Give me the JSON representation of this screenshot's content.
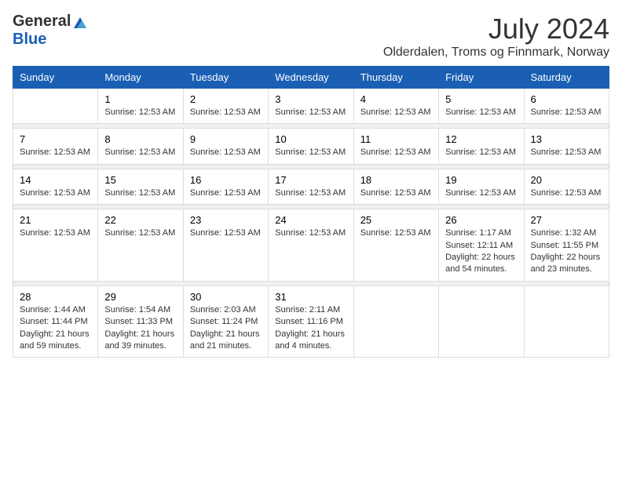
{
  "logo": {
    "general": "General",
    "blue": "Blue"
  },
  "title": "July 2024",
  "location": "Olderdalen, Troms og Finnmark, Norway",
  "days_of_week": [
    "Sunday",
    "Monday",
    "Tuesday",
    "Wednesday",
    "Thursday",
    "Friday",
    "Saturday"
  ],
  "weeks": [
    [
      {
        "day": "",
        "info": ""
      },
      {
        "day": "1",
        "info": "Sunrise: 12:53 AM"
      },
      {
        "day": "2",
        "info": "Sunrise: 12:53 AM"
      },
      {
        "day": "3",
        "info": "Sunrise: 12:53 AM"
      },
      {
        "day": "4",
        "info": "Sunrise: 12:53 AM"
      },
      {
        "day": "5",
        "info": "Sunrise: 12:53 AM"
      },
      {
        "day": "6",
        "info": "Sunrise: 12:53 AM"
      }
    ],
    [
      {
        "day": "7",
        "info": "Sunrise: 12:53 AM"
      },
      {
        "day": "8",
        "info": "Sunrise: 12:53 AM"
      },
      {
        "day": "9",
        "info": "Sunrise: 12:53 AM"
      },
      {
        "day": "10",
        "info": "Sunrise: 12:53 AM"
      },
      {
        "day": "11",
        "info": "Sunrise: 12:53 AM"
      },
      {
        "day": "12",
        "info": "Sunrise: 12:53 AM"
      },
      {
        "day": "13",
        "info": "Sunrise: 12:53 AM"
      }
    ],
    [
      {
        "day": "14",
        "info": "Sunrise: 12:53 AM"
      },
      {
        "day": "15",
        "info": "Sunrise: 12:53 AM"
      },
      {
        "day": "16",
        "info": "Sunrise: 12:53 AM"
      },
      {
        "day": "17",
        "info": "Sunrise: 12:53 AM"
      },
      {
        "day": "18",
        "info": "Sunrise: 12:53 AM"
      },
      {
        "day": "19",
        "info": "Sunrise: 12:53 AM"
      },
      {
        "day": "20",
        "info": "Sunrise: 12:53 AM"
      }
    ],
    [
      {
        "day": "21",
        "info": "Sunrise: 12:53 AM"
      },
      {
        "day": "22",
        "info": "Sunrise: 12:53 AM"
      },
      {
        "day": "23",
        "info": "Sunrise: 12:53 AM"
      },
      {
        "day": "24",
        "info": "Sunrise: 12:53 AM"
      },
      {
        "day": "25",
        "info": "Sunrise: 12:53 AM"
      },
      {
        "day": "26",
        "info": "Sunrise: 1:17 AM\nSunset: 12:11 AM\nDaylight: 22 hours and 54 minutes."
      },
      {
        "day": "27",
        "info": "Sunrise: 1:32 AM\nSunset: 11:55 PM\nDaylight: 22 hours and 23 minutes."
      }
    ],
    [
      {
        "day": "28",
        "info": "Sunrise: 1:44 AM\nSunset: 11:44 PM\nDaylight: 21 hours and 59 minutes."
      },
      {
        "day": "29",
        "info": "Sunrise: 1:54 AM\nSunset: 11:33 PM\nDaylight: 21 hours and 39 minutes."
      },
      {
        "day": "30",
        "info": "Sunrise: 2:03 AM\nSunset: 11:24 PM\nDaylight: 21 hours and 21 minutes."
      },
      {
        "day": "31",
        "info": "Sunrise: 2:11 AM\nSunset: 11:16 PM\nDaylight: 21 hours and 4 minutes."
      },
      {
        "day": "",
        "info": ""
      },
      {
        "day": "",
        "info": ""
      },
      {
        "day": "",
        "info": ""
      }
    ]
  ]
}
